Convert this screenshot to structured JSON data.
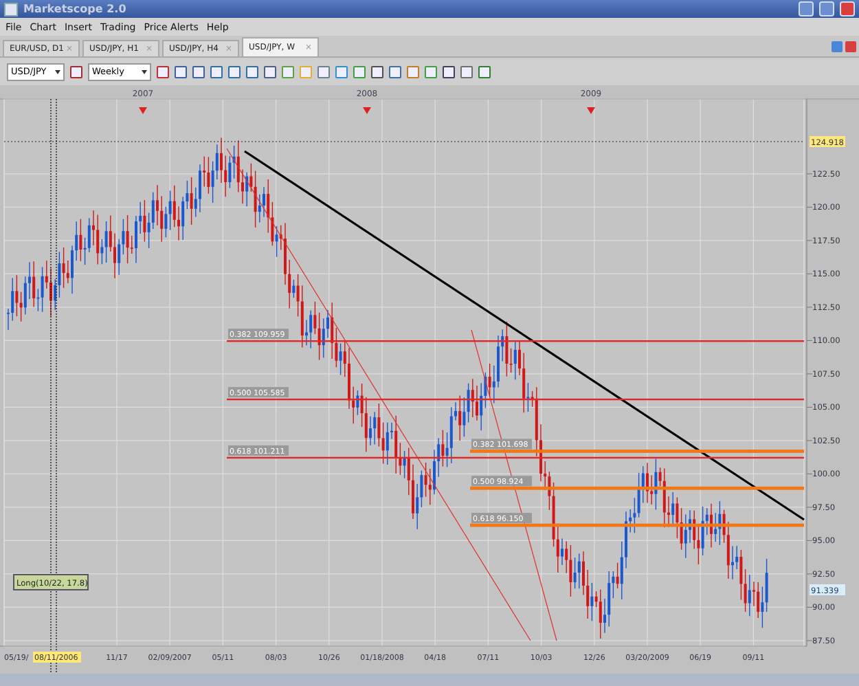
{
  "window": {
    "title": "Marketscope 2.0"
  },
  "menu": [
    "File",
    "Chart",
    "Insert",
    "Trading",
    "Price Alerts",
    "Help"
  ],
  "tabs": [
    {
      "label": "EUR/USD, D1",
      "close": "×",
      "selected": false
    },
    {
      "label": "USD/JPY, H1",
      "close": "×",
      "selected": false
    },
    {
      "label": "USD/JPY, H4",
      "close": "×",
      "selected": false
    },
    {
      "label": "USD/JPY, W",
      "close": "×",
      "selected": true
    }
  ],
  "toolbar": {
    "symbol": "USD/JPY",
    "timeframe": "Weekly"
  },
  "chart": {
    "years": [
      "2007",
      "2008",
      "2009"
    ],
    "price_ticks": [
      "122.50",
      "120.00",
      "117.50",
      "115.00",
      "112.50",
      "110.00",
      "107.50",
      "105.00",
      "102.50",
      "100.00",
      "97.50",
      "95.00",
      "92.50",
      "90.00",
      "87.50"
    ],
    "high_label": "124.918",
    "last_price": "91.339",
    "axis_cut_label": "05/19/",
    "crosshair": {
      "date": "08/11/2006",
      "label": "Long(10/22, 17.8)"
    },
    "dates": [
      "11/17",
      "02/09/2007",
      "05/11",
      "08/03",
      "10/26",
      "01/18/2008",
      "04/18",
      "07/11",
      "10/03",
      "12/26",
      "03/20/2009",
      "06/19",
      "09/11"
    ],
    "fib_sets": [
      {
        "color": "#e02828",
        "levels": [
          "0.382 109.959",
          "0.500 105.585",
          "0.618 101.211"
        ]
      },
      {
        "color": "#f07818",
        "levels": [
          "0.382 101.698",
          "0.500 98.924",
          "0.618 96.150"
        ]
      }
    ]
  }
}
